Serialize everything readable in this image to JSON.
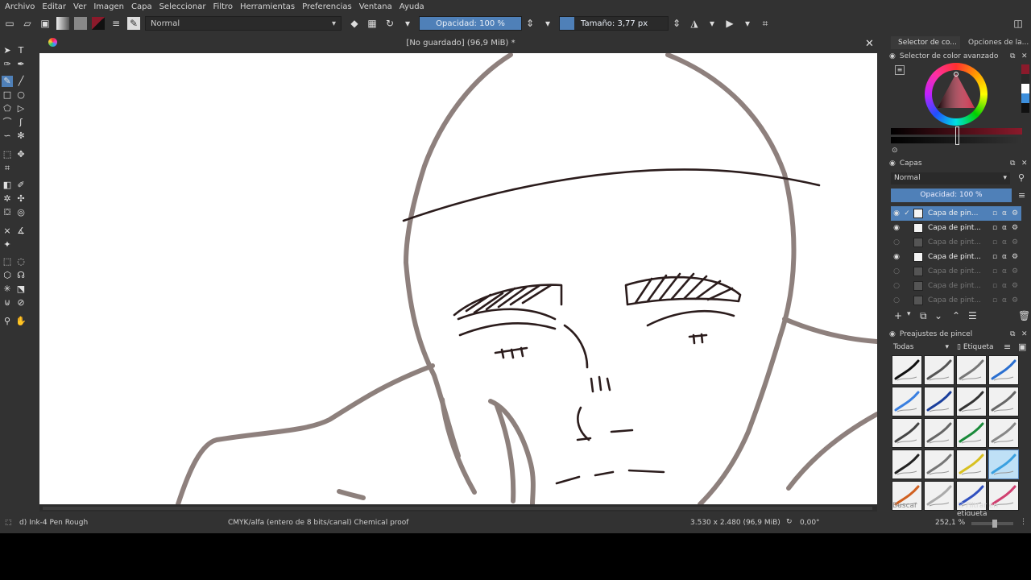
{
  "menu": [
    "Archivo",
    "Editar",
    "Ver",
    "Imagen",
    "Capa",
    "Seleccionar",
    "Filtro",
    "Herramientas",
    "Preferencias",
    "Ventana",
    "Ayuda"
  ],
  "toolbar": {
    "blend_mode": "Normal",
    "opacity": "Opacidad: 100 %",
    "size": "Tamaño: 3,77 px"
  },
  "document": {
    "title": "[No guardado]  (96,9 MiB) *",
    "close_glyph": "✕"
  },
  "dock": {
    "tab1": "Selector de co...",
    "tab2": "Opciones de la...",
    "color_panel_title": "Selector de color avanzado",
    "layers_title": "Capas",
    "layers_blend": "Normal",
    "layers_opacity": "Opacidad:  100 %",
    "layers": [
      {
        "name": "Capa de pin...",
        "visible": true,
        "active": true
      },
      {
        "name": "Capa de pint...",
        "visible": true,
        "active": false
      },
      {
        "name": "Capa de pint...",
        "visible": false,
        "active": false
      },
      {
        "name": "Capa de pint...",
        "visible": true,
        "active": false
      },
      {
        "name": "Capa de pint...",
        "visible": false,
        "active": false
      },
      {
        "name": "Capa de pint...",
        "visible": false,
        "active": false
      },
      {
        "name": "Capa de pint...",
        "visible": false,
        "active": false
      }
    ],
    "brushes_title": "Preajustes de pincel",
    "brushes_filter": "Todas",
    "brushes_tag": "Etiqueta",
    "search_placeholder": "Buscar",
    "filter_tag": "Filtrar en etiqueta"
  },
  "status": {
    "brush": "d) Ink-4 Pen Rough",
    "color_mode": "CMYK/alfa (entero de 8 bits/canal)  Chemical proof",
    "dimensions": "3.530 x 2.480 (96,9 MiB)",
    "rotation": "0,00°",
    "zoom": "252,1 %"
  },
  "colors": {
    "accent": "#4f80b8",
    "foreground": "#8b1a2b",
    "sketch": "#7a6a66",
    "ink": "#2b1c1c"
  }
}
